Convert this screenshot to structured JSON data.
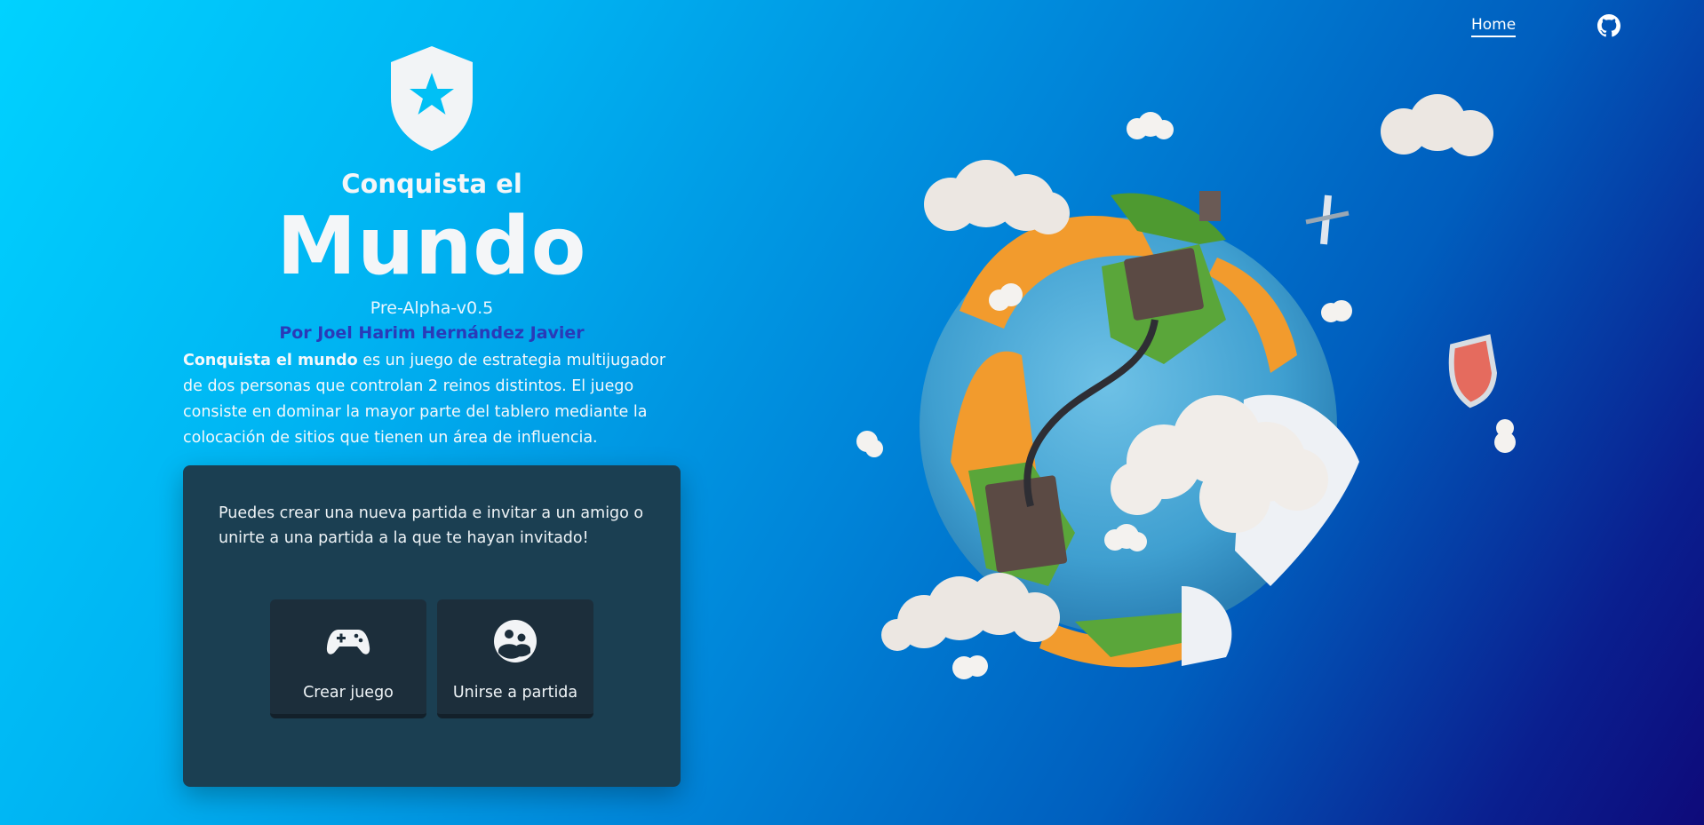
{
  "nav": {
    "home_label": "Home",
    "github_icon": "github-icon"
  },
  "hero": {
    "title_small": "Conquista el",
    "title_big": "Mundo",
    "version": "Pre-Alpha-v0.5",
    "author": "Por Joel Harim Hernández Javier",
    "description_bold": "Conquista el mundo",
    "description_rest": " es un juego de estrategia multijugador de dos personas que controlan 2 reinos distintos. El juego consiste en dominar la mayor parte del tablero mediante la colocación de sitios que tienen un área de influencia."
  },
  "card": {
    "text": "Puedes crear una nueva partida e invitar a un amigo o unirte a una partida a la que te hayan invitado!",
    "create_label": "Crear juego",
    "join_label": "Unirse a partida"
  },
  "colors": {
    "accent": "#00c8fb",
    "card_bg": "#1b3f52",
    "button_bg": "#1c2e3b",
    "author": "#2a3ab8"
  }
}
